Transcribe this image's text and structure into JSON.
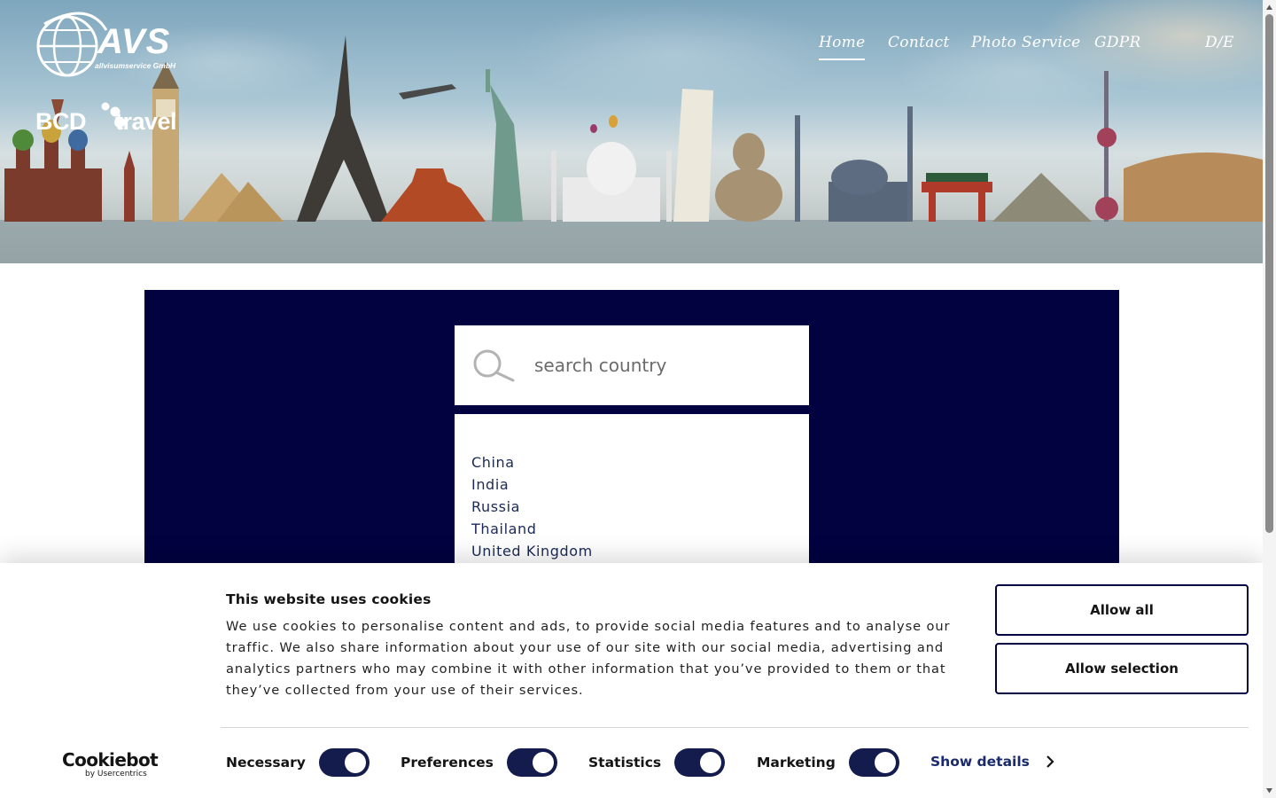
{
  "header": {
    "brand": {
      "name": "AVS",
      "subtitle": "allvisumservice GmbH",
      "partner": "BCD travel"
    },
    "nav": [
      {
        "label": "Home",
        "active": true
      },
      {
        "label": "Contact",
        "active": false
      },
      {
        "label": "Photo Service",
        "active": false
      },
      {
        "label": "GDPR",
        "active": false
      }
    ],
    "language": "D/E"
  },
  "search": {
    "placeholder": "search country",
    "value": "",
    "icon": "search-icon"
  },
  "countries": [
    "China",
    "India",
    "Russia",
    "Thailand",
    "United Kingdom"
  ],
  "cookie_banner": {
    "title": "This website uses cookies",
    "text": "We use cookies to personalise content and ads, to provide social media features and to analyse our traffic. We also share information about your use of our site with our social media, advertising and analytics partners who may combine it with other information that you’ve provided to them or that they’ve collected from your use of their services.",
    "allow_all": "Allow all",
    "allow_selection": "Allow selection",
    "toggles": [
      {
        "label": "Necessary",
        "checked": true
      },
      {
        "label": "Preferences",
        "checked": true
      },
      {
        "label": "Statistics",
        "checked": true
      },
      {
        "label": "Marketing",
        "checked": true
      }
    ],
    "show_details": "Show details",
    "logo": {
      "name": "Cookiebot",
      "byline": "by Usercentrics"
    }
  },
  "colors": {
    "navy": "#01023f",
    "toggle": "#141b4d",
    "link": "#1a2a6c",
    "list_text": "#1b2a55"
  }
}
